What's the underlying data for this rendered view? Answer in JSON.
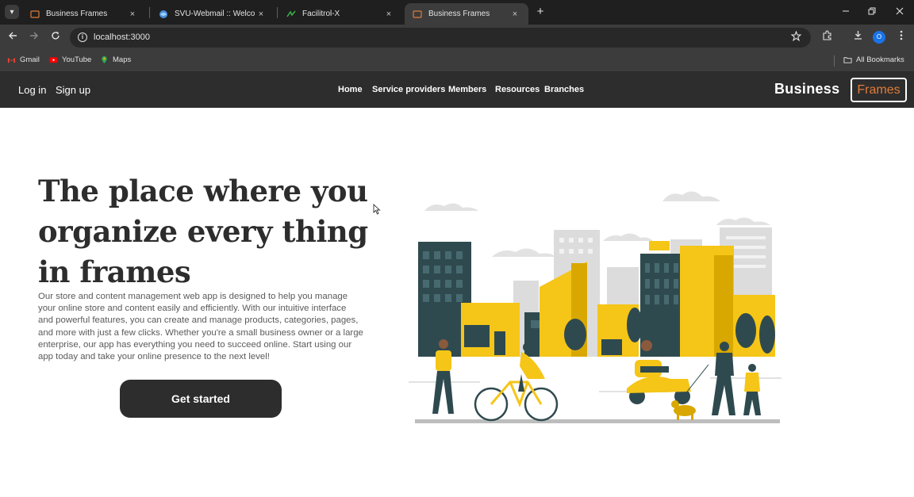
{
  "browser": {
    "tabs": [
      {
        "title": "Business Frames",
        "active": false
      },
      {
        "title": "SVU-Webmail :: Welcome",
        "active": false
      },
      {
        "title": "Facilitrol-X",
        "active": false
      },
      {
        "title": "Business Frames",
        "active": true
      }
    ],
    "close_glyph": "×",
    "new_tab_glyph": "+",
    "address": "localhost:3000",
    "profile_initial": "O",
    "bookmarks": [
      {
        "label": "Gmail",
        "icon": "gmail-icon"
      },
      {
        "label": "YouTube",
        "icon": "youtube-icon"
      },
      {
        "label": "Maps",
        "icon": "maps-icon"
      }
    ],
    "all_bookmarks": "All Bookmarks"
  },
  "nav": {
    "login": "Log in",
    "signup": "Sign up",
    "links": [
      "Home",
      "Service providers",
      "Members",
      "Resources",
      "Branches"
    ],
    "brand_word": "Business",
    "brand_box": "Frames"
  },
  "hero": {
    "title": "The place where you organize every thing in frames",
    "description": "Our store and content management web app is designed to help you manage your online store and content easily and efficiently. With our intuitive interface and powerful features, you can create and manage products, categories, pages, and more with just a few clicks. Whether you're a small business owner or a large enterprise, our app has everything you need to succeed online. Start using our app today and take your online presence to the next level!",
    "cta": "Get started"
  },
  "colors": {
    "accent_orange": "#e07b39",
    "dark": "#2d2d2d",
    "illustration_yellow": "#f5c518",
    "illustration_teal": "#2f4a4f"
  }
}
